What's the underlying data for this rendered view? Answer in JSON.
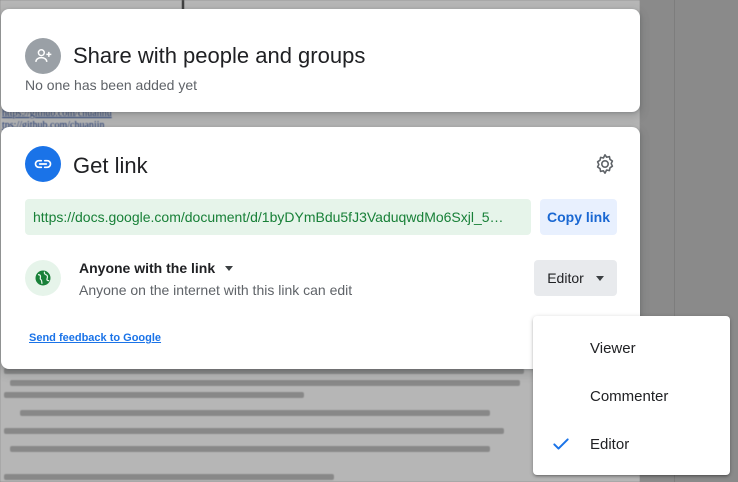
{
  "share": {
    "title": "Share with people and groups",
    "subtitle": "No one has been added yet"
  },
  "get_link": {
    "title": "Get link",
    "url": "https://docs.google.com/document/d/1byDYmBdu5fJ3VaduqwdMo6Sxjl_5…",
    "copy_label": "Copy link",
    "access_label": "Anyone with the link",
    "access_description": "Anyone on the internet with this link can edit",
    "role_label": "Editor",
    "feedback_label": "Send feedback to Google"
  },
  "role_menu": {
    "items": [
      {
        "label": "Viewer",
        "selected": false
      },
      {
        "label": "Commenter",
        "selected": false
      },
      {
        "label": "Editor",
        "selected": true
      }
    ]
  },
  "background_doc": {
    "link_1": "https://github.com/chuanhu",
    "link_2": "tps://github.com/chuanjin"
  },
  "colors": {
    "accent": "#1a73e8",
    "link_green": "#188038",
    "link_green_bg": "#e6f4ea",
    "copy_bg": "#e8f0fe"
  },
  "icons": {
    "share": "person-add-icon",
    "link": "link-icon",
    "settings": "gear-icon",
    "access": "globe-icon",
    "dropdown": "caret-down-icon",
    "selected": "check-icon"
  }
}
